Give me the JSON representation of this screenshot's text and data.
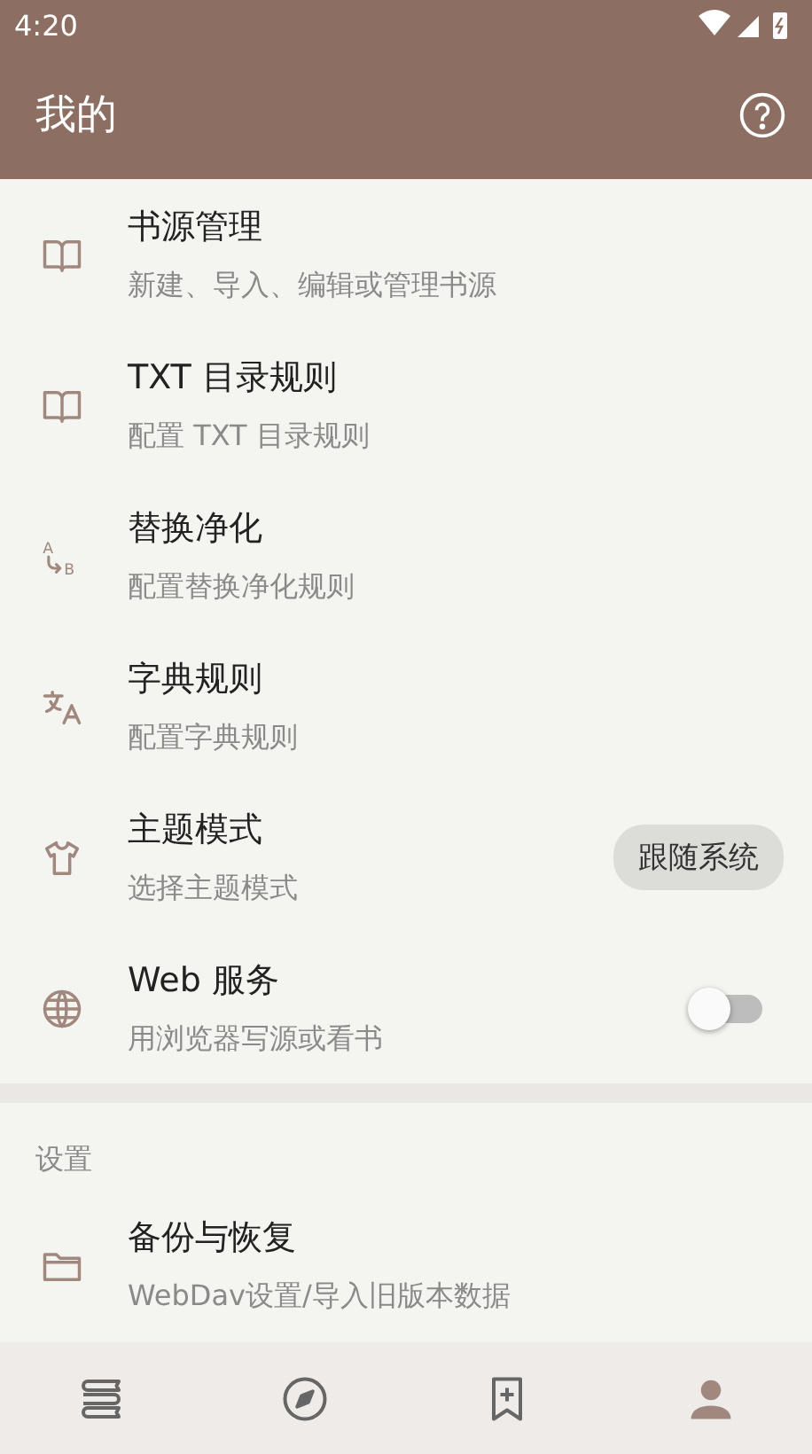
{
  "status_bar": {
    "time": "4:20"
  },
  "app_bar": {
    "title": "我的"
  },
  "items": [
    {
      "title": "书源管理",
      "subtitle": "新建、导入、编辑或管理书源",
      "kind": "plain"
    },
    {
      "title": "TXT 目录规则",
      "subtitle": "配置 TXT 目录规则",
      "kind": "plain"
    },
    {
      "title": "替换净化",
      "subtitle": "配置替换净化规则",
      "kind": "plain",
      "icon_letters": [
        "A",
        "B"
      ]
    },
    {
      "title": "字典规则",
      "subtitle": "配置字典规则",
      "kind": "plain"
    },
    {
      "title": "主题模式",
      "subtitle": "选择主题模式",
      "kind": "chip",
      "chip": "跟随系统"
    },
    {
      "title": "Web 服务",
      "subtitle": "用浏览器写源或看书",
      "kind": "switch",
      "on": false
    }
  ],
  "settings": {
    "header": "设置",
    "items": [
      {
        "title": "备份与恢复",
        "subtitle": "WebDav设置/导入旧版本数据",
        "kind": "plain"
      }
    ]
  },
  "bottom_nav": [
    {
      "selected": false
    },
    {
      "selected": false
    },
    {
      "selected": false
    },
    {
      "selected": true
    }
  ]
}
